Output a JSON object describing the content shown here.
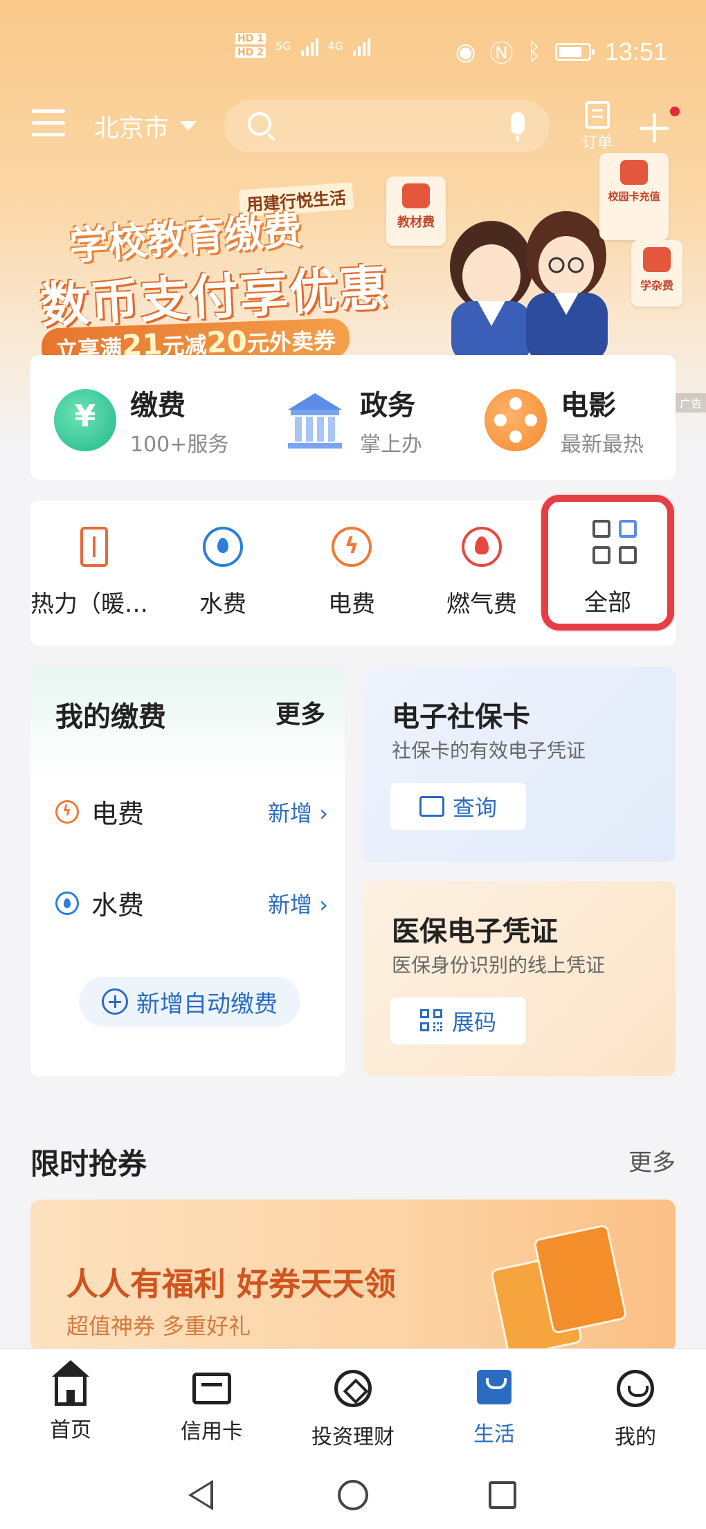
{
  "status_bar": {
    "hd1": "HD 1",
    "hd2": "HD 2",
    "net1": "5G",
    "net2": "4G",
    "time": "13:51",
    "icons": [
      "eye-icon",
      "nfc-icon",
      "bluetooth-icon",
      "battery-icon"
    ]
  },
  "header": {
    "city": "北京市",
    "orders_label": "订单"
  },
  "banner": {
    "tag": "用建行悦生活",
    "title1": "学校教育缴费",
    "title2": "数币支付享优惠",
    "promo_prefix": "立享满",
    "promo_n1": "21",
    "promo_mid": "元减",
    "promo_n2": "20",
    "promo_suffix": "元外卖券",
    "chip_textbook": "教材费",
    "chip_campus": "校园卡充值",
    "chip_misc": "学杂费",
    "ad_label": "广告"
  },
  "services": [
    {
      "title": "缴费",
      "sub": "100+服务",
      "icon": "yuan-hand-icon"
    },
    {
      "title": "政务",
      "sub": "掌上办",
      "icon": "government-building-icon"
    },
    {
      "title": "电影",
      "sub": "最新最热",
      "icon": "film-reel-icon"
    }
  ],
  "quick": [
    {
      "label": "热力（暖…",
      "icon": "thermometer-icon"
    },
    {
      "label": "水费",
      "icon": "water-drop-icon"
    },
    {
      "label": "电费",
      "icon": "lightning-icon"
    },
    {
      "label": "燃气费",
      "icon": "flame-icon"
    },
    {
      "label": "全部",
      "icon": "grid-icon"
    }
  ],
  "my_bills": {
    "title": "我的缴费",
    "more": "更多",
    "rows": [
      {
        "name": "电费",
        "action": "新增 ›"
      },
      {
        "name": "水费",
        "action": "新增 ›"
      }
    ],
    "auto_button": "新增自动缴费"
  },
  "social_card": {
    "title": "电子社保卡",
    "sub": "社保卡的有效电子凭证",
    "button": "查询"
  },
  "medical_card": {
    "title": "医保电子凭证",
    "sub": "医保身份识别的线上凭证",
    "button": "展码"
  },
  "coupons": {
    "title": "限时抢券",
    "more": "更多",
    "banner_title": "人人有福利 好券天天领",
    "banner_sub": "超值神券 多重好礼"
  },
  "tabbar": [
    {
      "label": "首页",
      "icon": "home-icon",
      "active": false
    },
    {
      "label": "信用卡",
      "icon": "credit-card-icon",
      "active": false
    },
    {
      "label": "投资理财",
      "icon": "investment-icon",
      "active": false
    },
    {
      "label": "生活",
      "icon": "life-bag-icon",
      "active": true
    },
    {
      "label": "我的",
      "icon": "profile-icon",
      "active": false
    }
  ],
  "colors": {
    "accent_blue": "#2a6cc1",
    "highlight_red": "#e43f45",
    "banner_orange": "#f9c98a"
  }
}
